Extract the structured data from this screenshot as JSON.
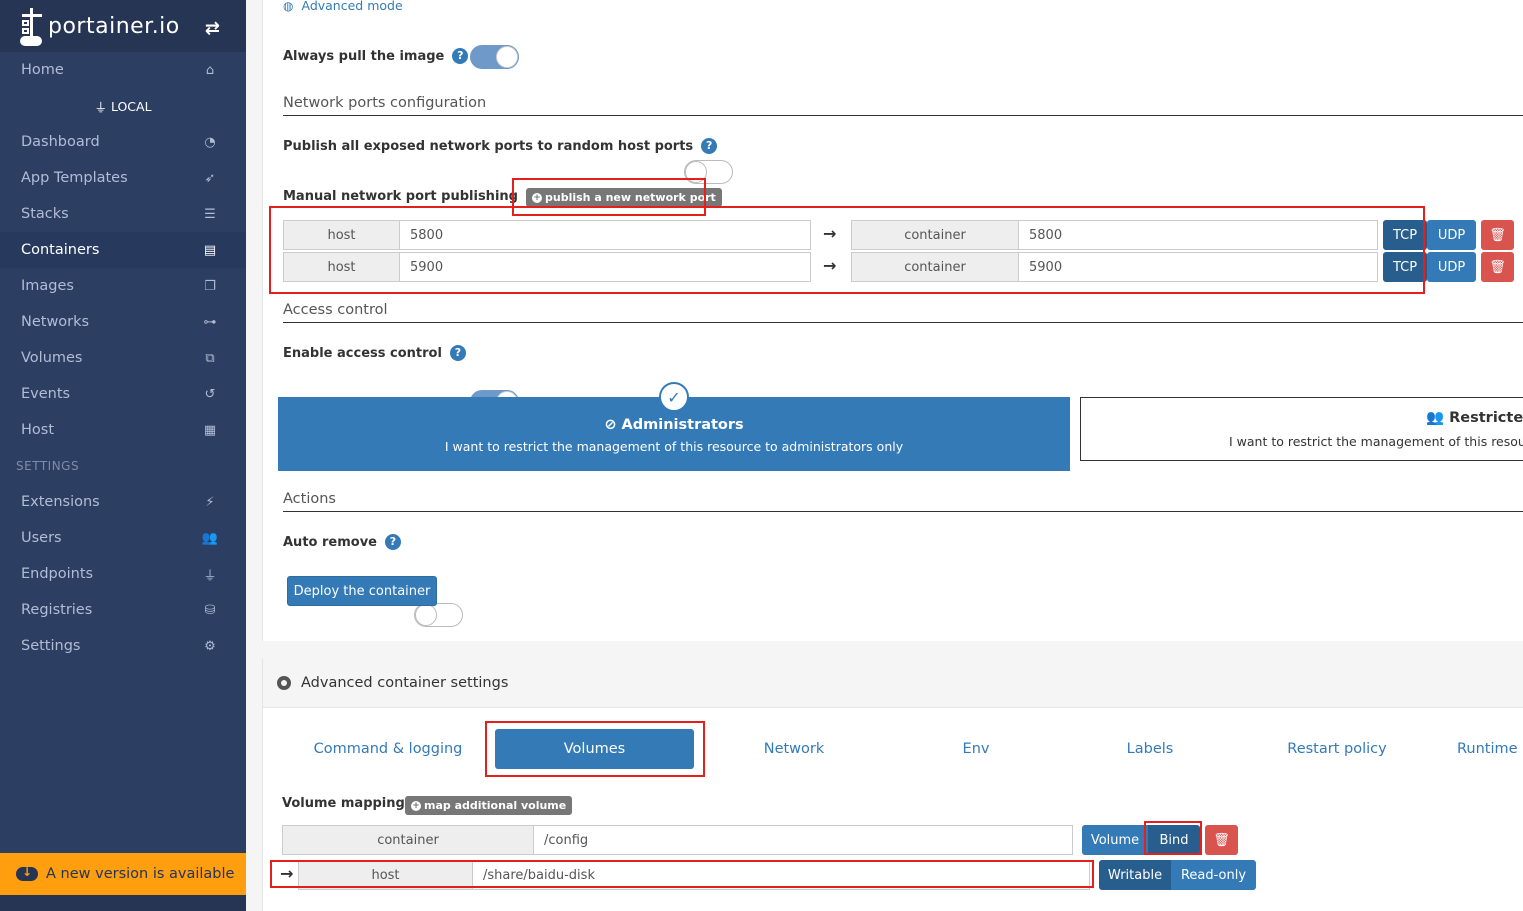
{
  "brand": {
    "name": "portainer.io"
  },
  "sidebar": {
    "home": "Home",
    "endpoint": "LOCAL",
    "items": [
      {
        "label": "Dashboard",
        "icon": "dashboard-icon"
      },
      {
        "label": "App Templates",
        "icon": "rocket-icon"
      },
      {
        "label": "Stacks",
        "icon": "th-list-icon"
      },
      {
        "label": "Containers",
        "icon": "server-icon"
      },
      {
        "label": "Images",
        "icon": "clone-icon"
      },
      {
        "label": "Networks",
        "icon": "sitemap-icon"
      },
      {
        "label": "Volumes",
        "icon": "cubes-icon"
      },
      {
        "label": "Events",
        "icon": "history-icon"
      },
      {
        "label": "Host",
        "icon": "th-icon"
      }
    ],
    "settings_heading": "SETTINGS",
    "settings_items": [
      {
        "label": "Extensions",
        "icon": "bolt-icon"
      },
      {
        "label": "Users",
        "icon": "users-icon"
      },
      {
        "label": "Endpoints",
        "icon": "plug-icon"
      },
      {
        "label": "Registries",
        "icon": "database-icon"
      },
      {
        "label": "Settings",
        "icon": "cogs-icon"
      }
    ],
    "update_notice": "A new version is available"
  },
  "form": {
    "advanced_mode": "Advanced mode",
    "always_pull": "Always pull the image",
    "always_pull_on": true,
    "network_ports_title": "Network ports configuration",
    "publish_all": "Publish all exposed network ports to random host ports",
    "publish_all_on": false,
    "manual_publishing": "Manual network port publishing",
    "publish_new_port": "publish a new network port",
    "ports": [
      {
        "host_label": "host",
        "host_value": "5800",
        "container_label": "container",
        "container_value": "5800",
        "tcp": "TCP",
        "udp": "UDP"
      },
      {
        "host_label": "host",
        "host_value": "5900",
        "container_label": "container",
        "container_value": "5900",
        "tcp": "TCP",
        "udp": "UDP"
      }
    ],
    "access_control_title": "Access control",
    "enable_access_control": "Enable access control",
    "enable_access_control_on": true,
    "administrators_title": "Administrators",
    "administrators_desc": "I want to restrict the management of this resource to administrators only",
    "restricted_title": "Restricted",
    "restricted_desc": "I want to restrict the management of this resource to a set of users and/or teams",
    "actions_title": "Actions",
    "auto_remove": "Auto remove",
    "auto_remove_on": false,
    "deploy_button": "Deploy the container"
  },
  "advanced": {
    "title": "Advanced container settings",
    "tabs": [
      "Command & logging",
      "Volumes",
      "Network",
      "Env",
      "Labels",
      "Restart policy",
      "Runtime"
    ],
    "active_tab": "Volumes",
    "volume_mapping": "Volume mapping",
    "map_additional": "map additional volume",
    "volume": {
      "container_label": "container",
      "container_value": "/config",
      "type_volume": "Volume",
      "type_bind": "Bind",
      "host_label": "host",
      "host_value": "/share/baidu-disk",
      "writable": "Writable",
      "readonly": "Read-only"
    }
  }
}
